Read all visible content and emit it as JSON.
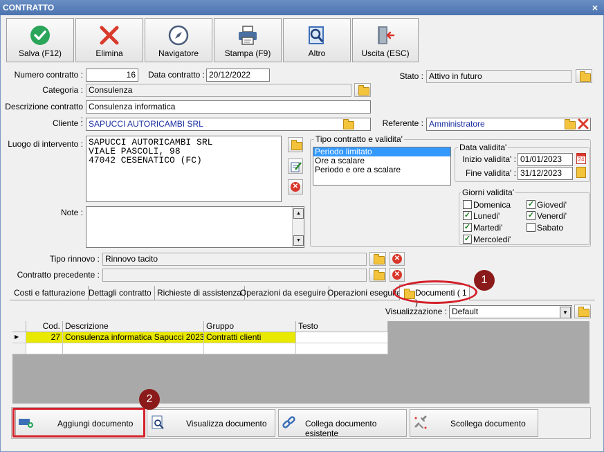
{
  "window": {
    "title": "CONTRATTO",
    "close_label": "×"
  },
  "toolbar": {
    "save": "Salva (F12)",
    "delete": "Elimina",
    "navigator": "Navigatore",
    "print": "Stampa (F9)",
    "other": "Altro",
    "exit": "Uscita (ESC)"
  },
  "form": {
    "numero_label": "Numero contratto :",
    "numero_value": "16",
    "data_label": "Data contratto :",
    "data_value": "20/12/2022",
    "stato_label": "Stato :",
    "stato_value": "Attivo in futuro",
    "categoria_label": "Categoria :",
    "categoria_value": "Consulenza",
    "descrizione_label": "Descrizione contratto :",
    "descrizione_value": "Consulenza informatica",
    "cliente_label": "Cliente :",
    "cliente_value": "SAPUCCI AUTORICAMBI SRL",
    "referente_label": "Referente :",
    "referente_value": "Amministratore",
    "luogo_label": "Luogo di intervento :",
    "luogo_lines": [
      "SAPUCCI AUTORICAMBI SRL",
      "VIALE PASCOLI, 98",
      "47042 CESENATICO (FC)"
    ],
    "note_label": "Note :",
    "tipo_rinnovo_label": "Tipo rinnovo :",
    "tipo_rinnovo_value": "Rinnovo tacito",
    "contratto_prec_label": "Contratto precedente :",
    "contratto_prec_value": ""
  },
  "tipo_contratto": {
    "title": "Tipo contratto e validita'",
    "options": [
      "Periodo limitato",
      "Ore a scalare",
      "Periodo e ore a scalare"
    ],
    "selected": "Periodo limitato"
  },
  "data_validita": {
    "title": "Data validita'",
    "inizio_label": "Inizio validita' :",
    "inizio_value": "01/01/2023",
    "fine_label": "Fine validita' :",
    "fine_value": "31/12/2023",
    "calendar_day": "24"
  },
  "giorni_validita": {
    "title": "Giorni validita'",
    "days": {
      "domenica": {
        "label": "Domenica",
        "checked": false
      },
      "lunedi": {
        "label": "Lunedi'",
        "checked": true
      },
      "martedi": {
        "label": "Martedi'",
        "checked": true
      },
      "mercoledi": {
        "label": "Mercoledi'",
        "checked": true
      },
      "giovedi": {
        "label": "Giovedi'",
        "checked": true
      },
      "venerdi": {
        "label": "Venerdi'",
        "checked": true
      },
      "sabato": {
        "label": "Sabato",
        "checked": false
      }
    }
  },
  "tabs": [
    "Costi e fatturazione",
    "Dettagli contratto",
    "Richieste di assistenza",
    "Operazioni da eseguire",
    "Operazioni eseguite",
    "Documenti ( 1 )"
  ],
  "active_tab": "Documenti ( 1 )",
  "visualizzazione": {
    "label": "Visualizzazione :",
    "value": "Default"
  },
  "grid": {
    "columns": [
      "Cod.",
      "Descrizione",
      "Gruppo",
      "Testo"
    ],
    "rows": [
      {
        "cod": "27",
        "descrizione": "Consulenza informatica Sapucci 2023",
        "gruppo": "Contratti clienti",
        "testo": ""
      }
    ],
    "highlight_color": "#e8e800"
  },
  "bottom_buttons": {
    "add": "Aggiungi documento",
    "view": "Visualizza documento",
    "link": "Collega documento esistente",
    "unlink": "Scollega documento"
  },
  "markers": {
    "one": "1",
    "two": "2"
  },
  "colors": {
    "titlebar": "#5a80bb",
    "accent_red": "#d4202a",
    "marker": "#8b1a1a",
    "selection": "#3399ff"
  }
}
